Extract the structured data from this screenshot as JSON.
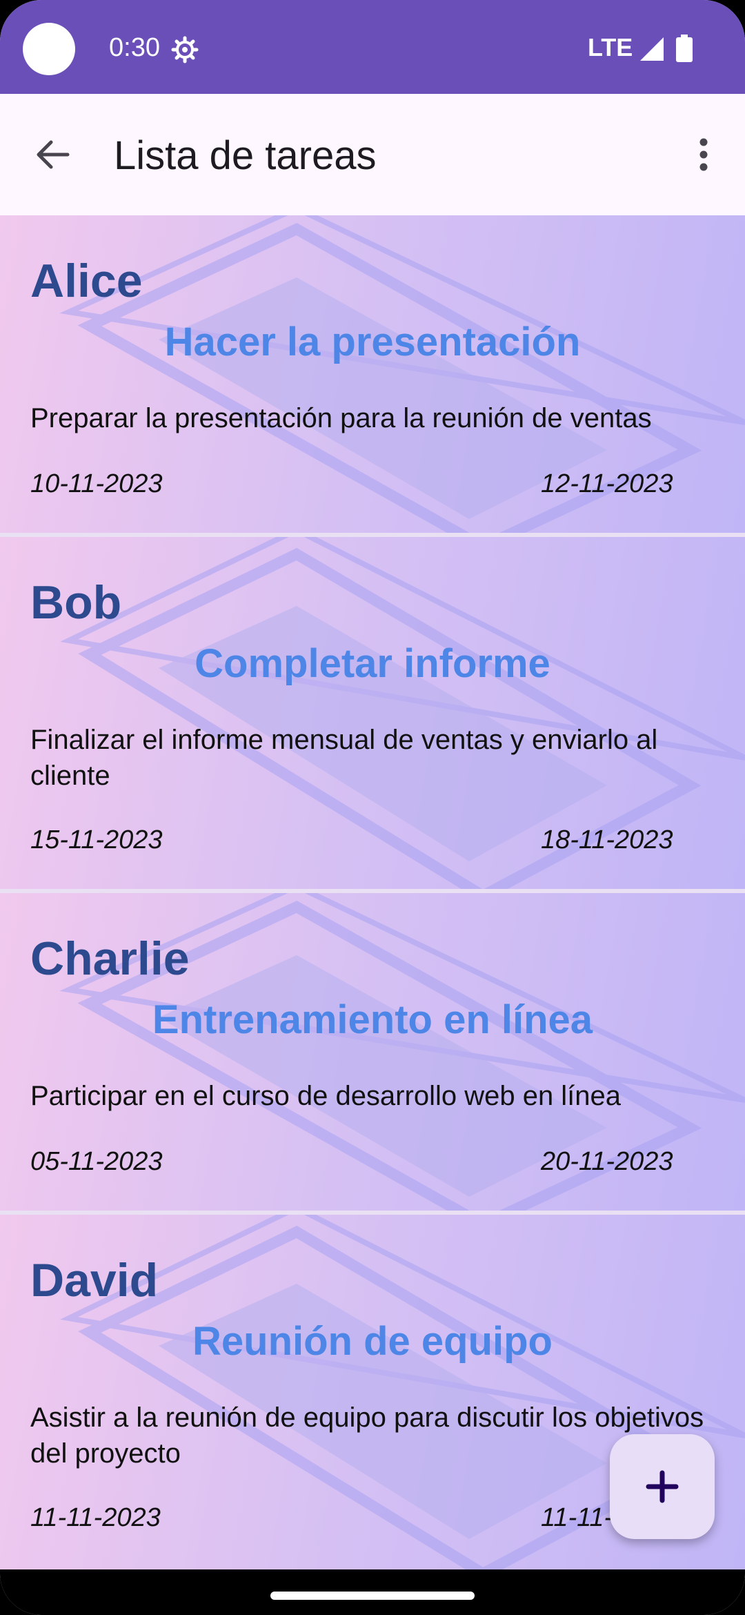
{
  "status_bar": {
    "time": "0:30",
    "network": "LTE",
    "icons": [
      "settings-icon",
      "signal-icon",
      "battery-icon"
    ]
  },
  "app_bar": {
    "title": "Lista de tareas",
    "back_icon": "arrow-back-icon",
    "menu_icon": "more-vert-icon"
  },
  "tasks": [
    {
      "name": "Alice",
      "title": "Hacer la presentación",
      "description": "Preparar la presentación para la reunión de ventas",
      "start_date": "10-11-2023",
      "end_date": "12-11-2023"
    },
    {
      "name": "Bob",
      "title": "Completar informe",
      "description": "Finalizar el informe mensual de ventas y enviarlo al cliente",
      "start_date": "15-11-2023",
      "end_date": "18-11-2023"
    },
    {
      "name": "Charlie",
      "title": "Entrenamiento en línea",
      "description": "Participar en el curso de desarrollo web en línea",
      "start_date": "05-11-2023",
      "end_date": "20-11-2023"
    },
    {
      "name": "David",
      "title": "Reunión de equipo",
      "description": "Asistir a la reunión de equipo para discutir los objetivos del proyecto",
      "start_date": "11-11-2023",
      "end_date": "11-11-2023"
    }
  ],
  "fab": {
    "icon": "plus-icon"
  },
  "colors": {
    "status_bar": "#6a4fb9",
    "name_text": "#2e4a8f",
    "task_title_text": "#4d86e6",
    "fab_background": "#e8def8"
  }
}
